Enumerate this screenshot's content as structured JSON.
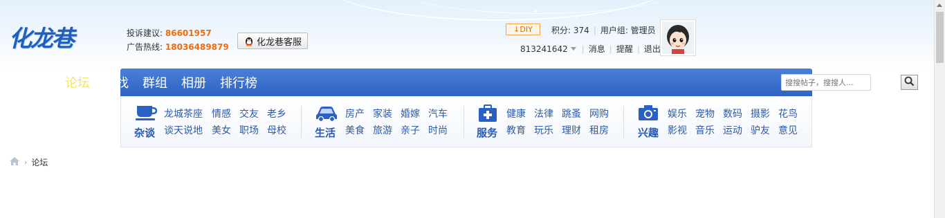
{
  "header": {
    "logo_text": "化龙巷",
    "complaint_label": "投诉建议:",
    "complaint_number": "86601957",
    "ad_label": "广告热线:",
    "ad_number": "18036489879",
    "kefu_label": "化龙巷客服"
  },
  "user": {
    "diy_label": "DIY",
    "points": "积分: 374",
    "group": "用户组: 管理员",
    "user_id": "813241642",
    "messages": "消息",
    "reminders": "提醒",
    "logout": "退出"
  },
  "nav": {
    "active": "论坛",
    "partial": "找",
    "items": [
      "群组",
      "相册",
      "排行榜"
    ]
  },
  "search": {
    "placeholder": "搜搜帖子，搜搜人..."
  },
  "sub_nav": {
    "groups": [
      {
        "title": "杂谈",
        "icon": "cup-icon",
        "row1": [
          "龙城茶座",
          "情感",
          "交友",
          "老乡"
        ],
        "row2": [
          "谈天说地",
          "美女",
          "职场",
          "母校"
        ]
      },
      {
        "title": "生活",
        "icon": "car-icon",
        "row1": [
          "房产",
          "家装",
          "婚嫁",
          "汽车"
        ],
        "row2": [
          "美食",
          "旅游",
          "亲子",
          "时尚"
        ]
      },
      {
        "title": "服务",
        "icon": "medical-kit-icon",
        "row1": [
          "健康",
          "法律",
          "跳蚤",
          "网购"
        ],
        "row2": [
          "教育",
          "玩乐",
          "理财",
          "租房"
        ]
      },
      {
        "title": "兴趣",
        "icon": "camera-icon",
        "row1": [
          "娱乐",
          "宠物",
          "数码",
          "摄影",
          "花鸟"
        ],
        "row2": [
          "影视",
          "音乐",
          "运动",
          "驴友",
          "意见"
        ]
      }
    ]
  },
  "breadcrumb": {
    "current": "论坛"
  },
  "colors": {
    "nav_blue": "#2f63c4",
    "link_blue": "#2d5aa8",
    "accent_orange": "#f26b0e",
    "active_yellow": "#f8e35c"
  }
}
